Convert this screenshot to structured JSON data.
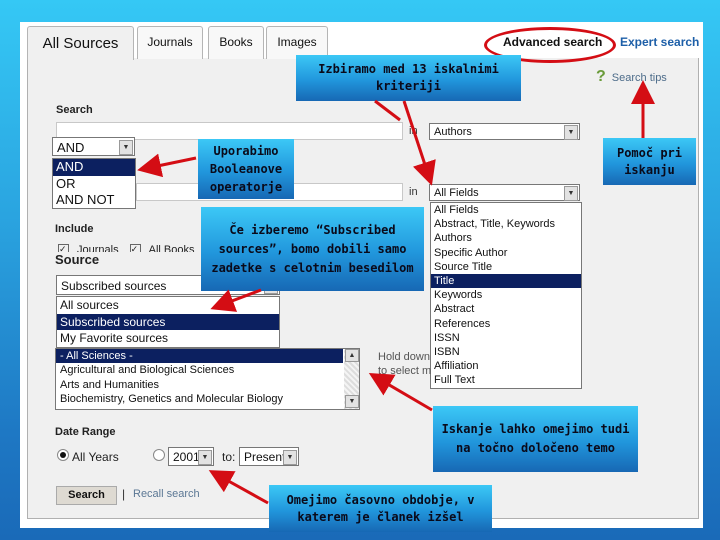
{
  "tabs": [
    {
      "label": "All Sources",
      "active": true
    },
    {
      "label": "Journals",
      "active": false
    },
    {
      "label": "Books",
      "active": false
    },
    {
      "label": "Images",
      "active": false
    }
  ],
  "header_links": {
    "advanced_search": "Advanced search",
    "expert_search": "Expert search",
    "search_tips": "Search tips",
    "search_tips_icon": "question-mark"
  },
  "search": {
    "label": "Search",
    "in_label": "in",
    "row1": {
      "value": "",
      "field": "Authors"
    },
    "boolean": {
      "selected": "AND",
      "options": [
        "AND",
        "OR",
        "AND NOT"
      ],
      "highlighted": "AND"
    },
    "row2": {
      "value": "",
      "field": "All Fields"
    },
    "field_options": [
      "All Fields",
      "Abstract, Title, Keywords",
      "Authors",
      "Specific Author",
      "Source Title",
      "Title",
      "Keywords",
      "Abstract",
      "References",
      "ISSN",
      "ISBN",
      "Affiliation",
      "Full Text"
    ],
    "field_highlighted": "Title"
  },
  "include": {
    "label": "Include",
    "items": [
      {
        "label": "Journals",
        "checked": true
      },
      {
        "label": "All Books",
        "checked": true
      }
    ]
  },
  "source": {
    "label": "Source",
    "selected": "Subscribed sources",
    "options": [
      "All sources",
      "Subscribed sources",
      "My Favorite sources"
    ],
    "highlighted": "Subscribed sources"
  },
  "subjects": {
    "options": [
      "- All Sciences -",
      "Agricultural and Biological Sciences",
      "Arts and Humanities",
      "Biochemistry, Genetics and Molecular Biology"
    ],
    "highlighted": "- All Sciences -",
    "hint_lines": [
      "Hold down",
      "to select m"
    ]
  },
  "date_range": {
    "label": "Date Range",
    "all_years_label": "All Years",
    "all_years_selected": true,
    "from_value": "2001",
    "to_label": "to:",
    "to_value": "Present"
  },
  "actions": {
    "search_button": "Search",
    "separator": "|",
    "recall_search": "Recall search"
  },
  "callouts": {
    "criteria": "Izbiramo med 13 iskalnimi kriteriji",
    "boolean": "Uporabimo Booleanove operatorje",
    "subscribed": "Če izberemo “Subscribed sources”, bomo dobili samo zadetke s celotnim besedilom",
    "help": "Pomoč pri iskanju",
    "subject": "Iskanje lahko omejimo tudi na točno določeno temo",
    "period": "Omejimo časovno obdobje, v katerem je članek izšel"
  },
  "colors": {
    "callout_top": "#3cc8f6",
    "callout_bottom": "#1768b4",
    "arrow": "#d40d14",
    "selection": "#0c2060",
    "link": "#1d5fa8"
  }
}
